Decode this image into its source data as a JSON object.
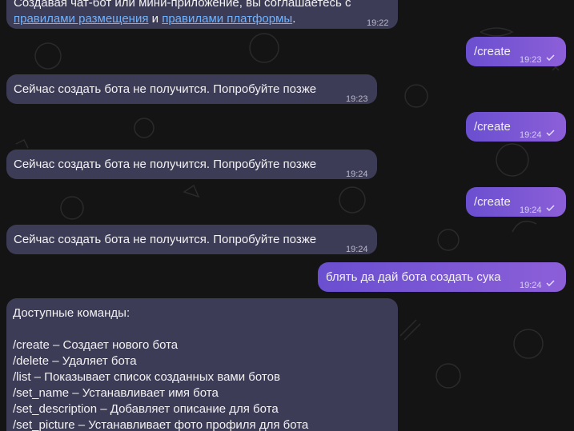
{
  "top_message": {
    "line1": "Создавая чат-бот или мини-приложение, вы соглашаетесь с",
    "link1": "правилами размещения",
    "and": "и",
    "link2": "правилами платформы",
    "period": ".",
    "time": "19:22"
  },
  "messages": [
    {
      "dir": "out",
      "text": "/create",
      "time": "19:23"
    },
    {
      "dir": "in",
      "text": "Сейчас создать бота не получится. Попробуйте позже",
      "time": "19:23"
    },
    {
      "dir": "out",
      "text": "/create",
      "time": "19:24"
    },
    {
      "dir": "in",
      "text": "Сейчас создать бота не получится. Попробуйте позже",
      "time": "19:24"
    },
    {
      "dir": "out",
      "text": "/create",
      "time": "19:24"
    },
    {
      "dir": "in",
      "text": "Сейчас создать бота не получится. Попробуйте позже",
      "time": "19:24"
    },
    {
      "dir": "out",
      "text": "блять да дай бота создать сука",
      "time": "19:24"
    }
  ],
  "commands": {
    "header": "Доступные команды:",
    "items": [
      "/create – Создает нового бота",
      "/delete – Удаляет бота",
      "/list – Показывает список созданных вами ботов",
      "/set_name – Устанавливает имя бота",
      "/set_description – Добавляет описание для бота",
      "/set_picture – Устанавливает фото профиля для бота"
    ]
  },
  "colors": {
    "incoming_bubble": "#3d3c57",
    "outgoing_gradient_start": "#6a4fd0",
    "outgoing_gradient_end": "#8c5fd8",
    "background": "#141414",
    "link": "#6fb3ff"
  },
  "icons": {
    "read_check": "check-icon"
  }
}
